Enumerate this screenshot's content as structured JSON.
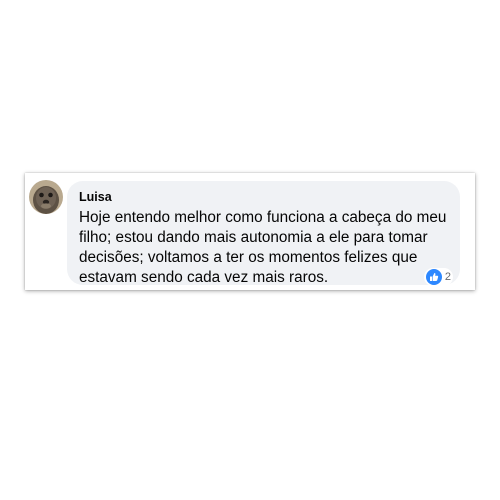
{
  "comment": {
    "author": "Luisa",
    "text": "Hoje entendo melhor como funciona a cabeça do meu\nfilho; estou dando mais autonomia a ele para tomar\ndecisões; voltamos a ter os momentos felizes que\nestavam sendo cada vez mais raros.",
    "reaction": {
      "icon": "like-icon",
      "count": "2"
    }
  },
  "colors": {
    "bubble": "#f0f2f5",
    "like_blue": "#2d88ff",
    "text": "#050505",
    "muted": "#65676b"
  }
}
